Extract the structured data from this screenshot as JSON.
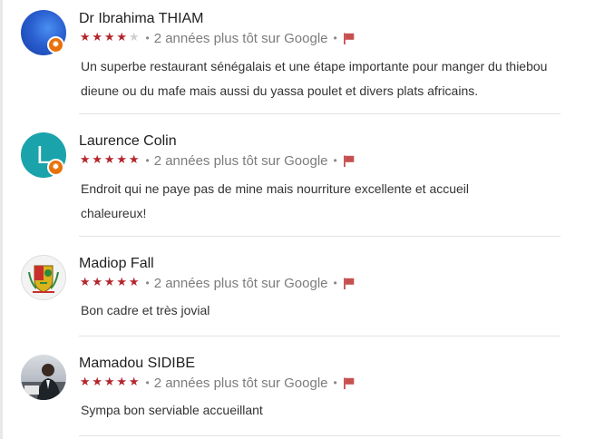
{
  "reviews": [
    {
      "name": "Dr Ibrahima THIAM",
      "rating": 4,
      "max_rating": 5,
      "when": "2 années plus tôt sur Google",
      "text": "Un superbe restaurant sénégalais et une étape importante pour manger du thiebou dieune ou du mafe mais aussi du yassa poulet et divers plats africains.",
      "avatar": {
        "type": "gradient",
        "colors": [
          "#1a46b8",
          "#3f84e5"
        ],
        "badge": true
      }
    },
    {
      "name": "Laurence Colin",
      "rating": 5,
      "max_rating": 5,
      "when": "2 années plus tôt sur Google",
      "text": "Endroit qui ne paye pas de mine mais nourriture excellente et accueil chaleureux!",
      "avatar": {
        "type": "letter",
        "letter": "L",
        "color": "#1aa3aa",
        "badge": true
      }
    },
    {
      "name": "Madiop Fall",
      "rating": 5,
      "max_rating": 5,
      "when": "2 années plus tôt sur Google",
      "text": "Bon cadre et très jovial",
      "avatar": {
        "type": "emblem",
        "badge": false
      }
    },
    {
      "name": "Mamadou SIDIBE",
      "rating": 5,
      "max_rating": 5,
      "when": "2 années plus tôt sur Google",
      "text": "Sympa bon serviable accueillant",
      "avatar": {
        "type": "photo",
        "badge": false
      }
    }
  ],
  "icons": {
    "star": "star-icon",
    "flag": "flag-icon",
    "badge": "local-guide-icon"
  },
  "colors": {
    "star": "#b3262d",
    "flag": "#c6504f",
    "meta": "#7c7c7c"
  }
}
